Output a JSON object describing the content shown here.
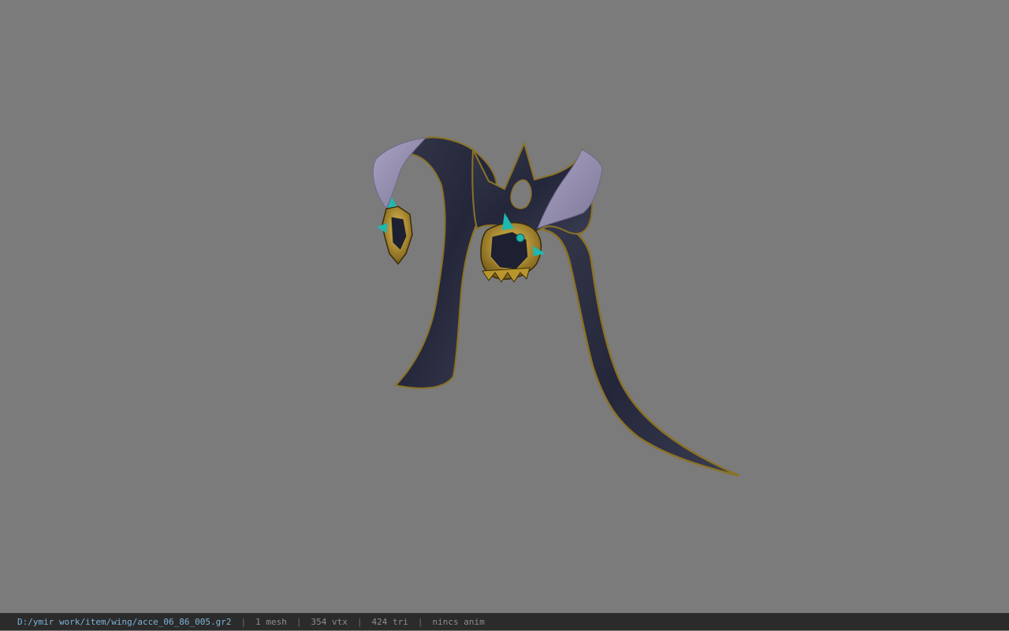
{
  "viewer": {
    "background_color": "#7b7b7b",
    "model_colors": {
      "cloth_dark": "#2a2c3a",
      "cloth_light": "#9f97b8",
      "gold": "#b8962e",
      "teal": "#1fb8b0"
    }
  },
  "statusbar": {
    "file_path": "D:/ymir work/item/wing/acce_06_86_005.gr2",
    "separator": "|",
    "mesh_count": "1 mesh",
    "vertex_count": "354 vtx",
    "triangle_count": "424 tri",
    "anim_status": "nincs anim"
  }
}
